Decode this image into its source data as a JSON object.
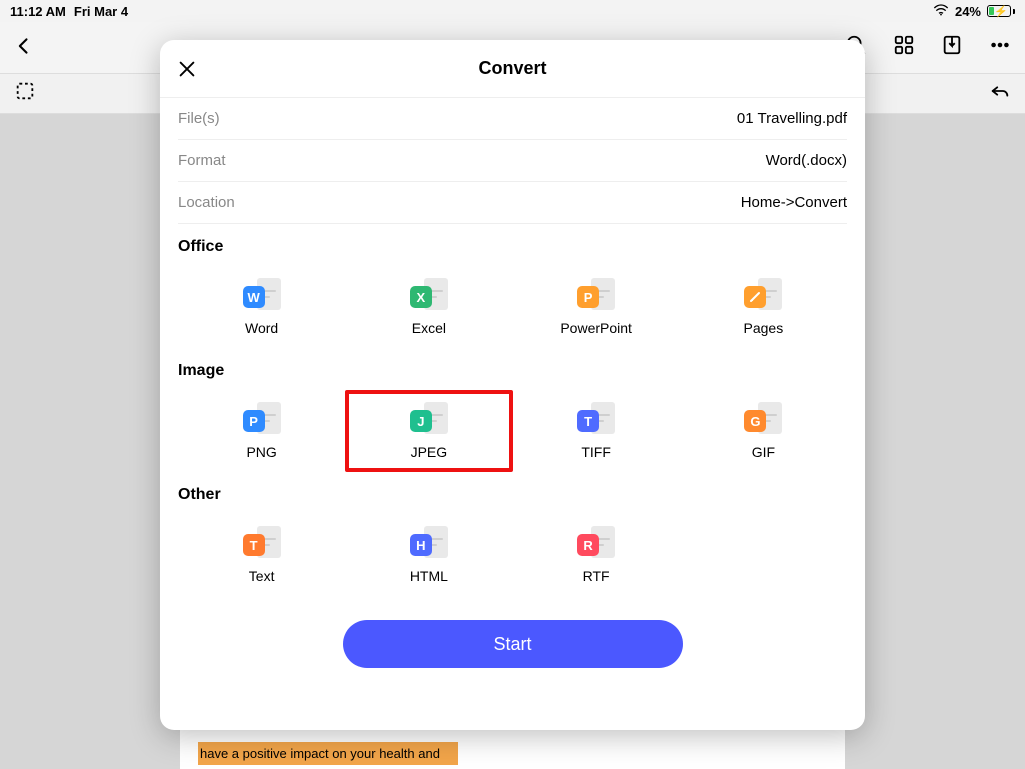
{
  "status": {
    "time": "11:12 AM",
    "date": "Fri Mar 4",
    "battery_pct": "24%"
  },
  "modal": {
    "title": "Convert",
    "rows": {
      "files_label": "File(s)",
      "files_value": "01 Travelling.pdf",
      "format_label": "Format",
      "format_value": "Word(.docx)",
      "location_label": "Location",
      "location_value": "Home->Convert"
    },
    "sections": {
      "office": "Office",
      "image": "Image",
      "other": "Other"
    },
    "formats": {
      "word": "Word",
      "excel": "Excel",
      "powerpoint": "PowerPoint",
      "pages": "Pages",
      "png": "PNG",
      "jpeg": "JPEG",
      "tiff": "TIFF",
      "gif": "GIF",
      "text": "Text",
      "html": "HTML",
      "rtf": "RTF"
    },
    "start": "Start",
    "highlighted_format": "jpeg"
  },
  "doc": {
    "highlight_line1": "have a positive impact on your health and"
  }
}
